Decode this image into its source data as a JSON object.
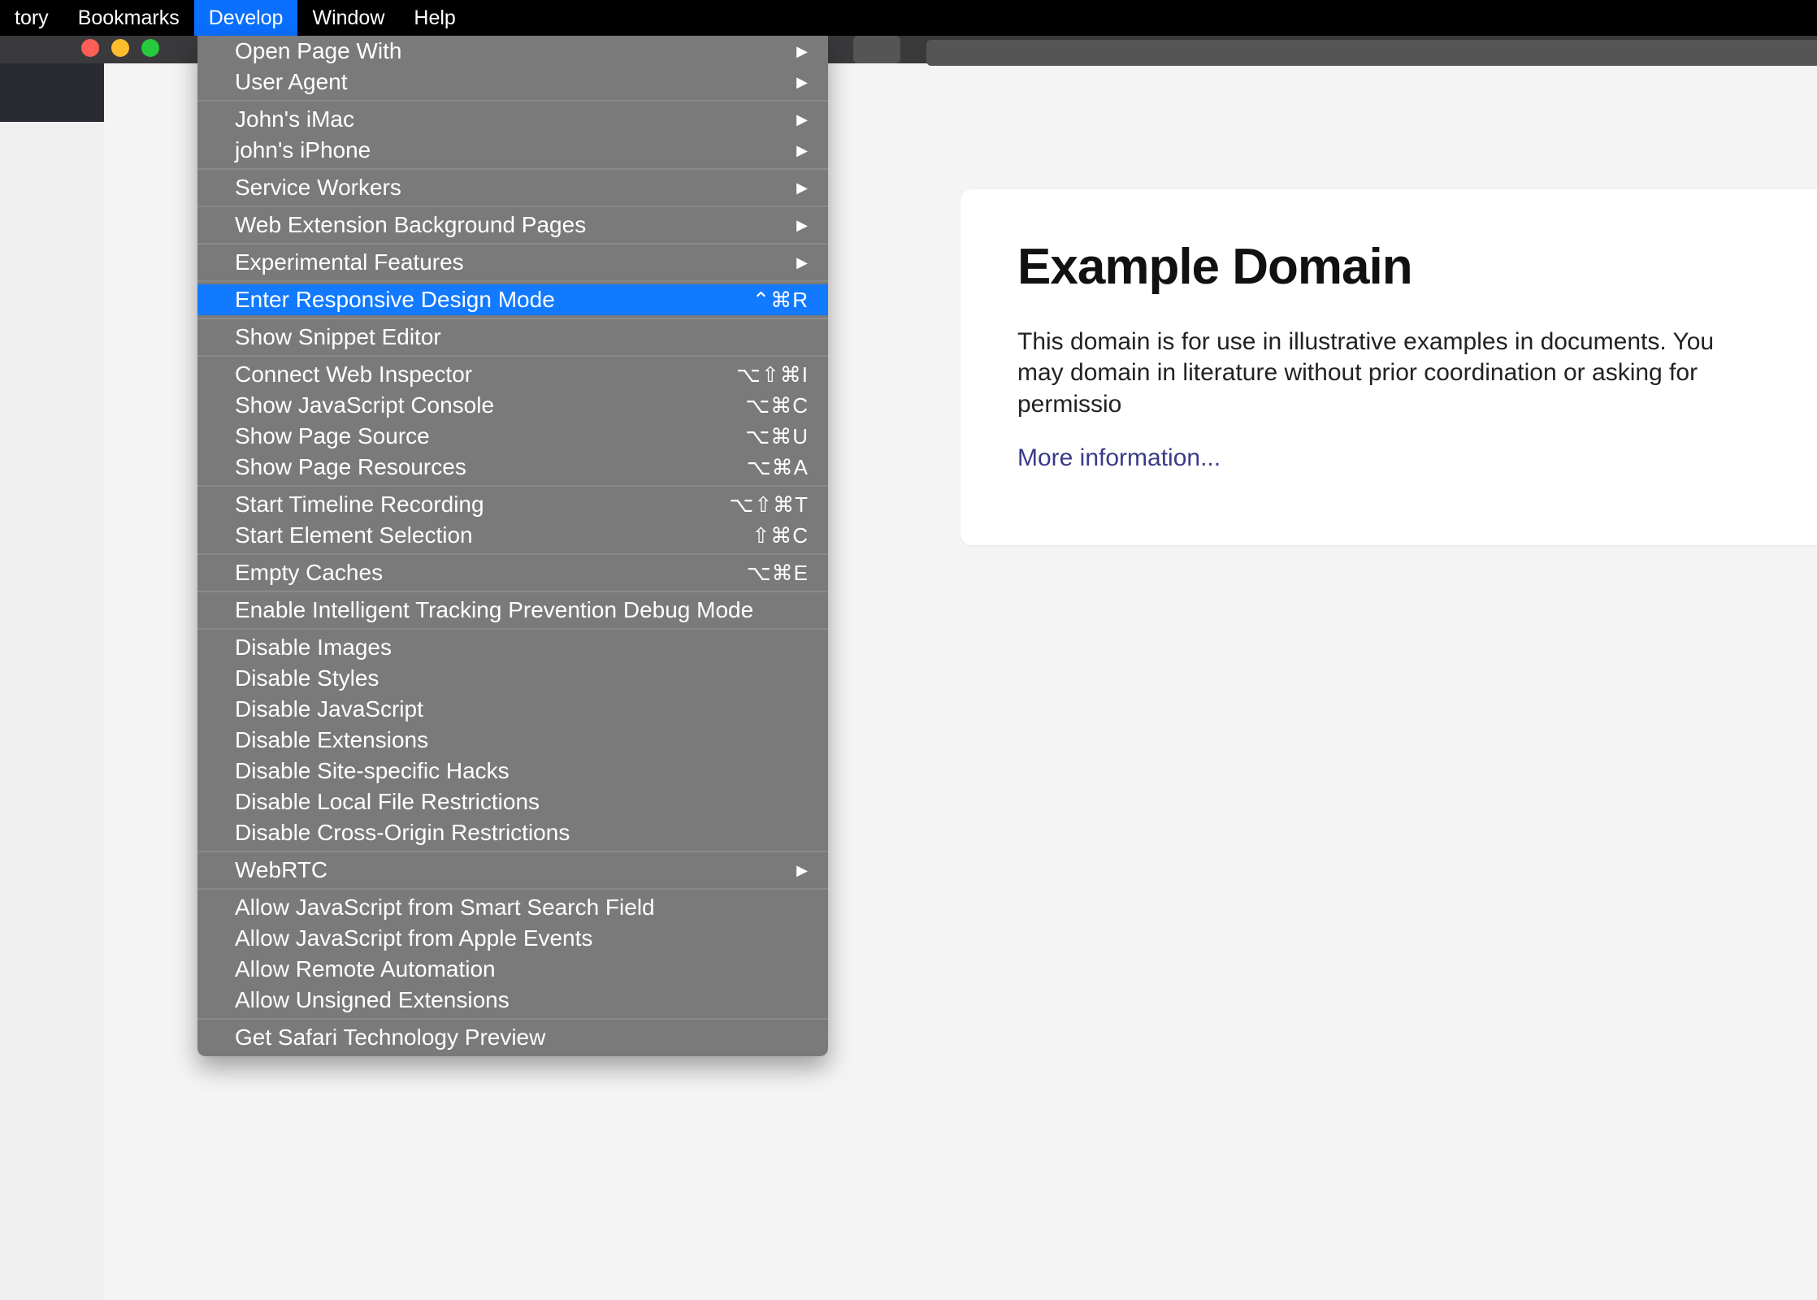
{
  "menubar": {
    "items": [
      {
        "label": "tory"
      },
      {
        "label": "Bookmarks"
      },
      {
        "label": "Develop",
        "selected": true
      },
      {
        "label": "Window"
      },
      {
        "label": "Help"
      }
    ]
  },
  "dropdown": {
    "groups": [
      [
        {
          "label": "Open Page With",
          "submenu": true
        },
        {
          "label": "User Agent",
          "submenu": true
        }
      ],
      [
        {
          "label": "John's iMac",
          "submenu": true
        },
        {
          "label": "john's iPhone",
          "submenu": true
        }
      ],
      [
        {
          "label": "Service Workers",
          "submenu": true
        }
      ],
      [
        {
          "label": "Web Extension Background Pages",
          "submenu": true
        }
      ],
      [
        {
          "label": "Experimental Features",
          "submenu": true
        }
      ],
      [
        {
          "label": "Enter Responsive Design Mode",
          "shortcut": "⌃⌘R",
          "highlighted": true
        }
      ],
      [
        {
          "label": "Show Snippet Editor"
        }
      ],
      [
        {
          "label": "Connect Web Inspector",
          "shortcut": "⌥⇧⌘I"
        },
        {
          "label": "Show JavaScript Console",
          "shortcut": "⌥⌘C"
        },
        {
          "label": "Show Page Source",
          "shortcut": "⌥⌘U"
        },
        {
          "label": "Show Page Resources",
          "shortcut": "⌥⌘A"
        }
      ],
      [
        {
          "label": "Start Timeline Recording",
          "shortcut": "⌥⇧⌘T"
        },
        {
          "label": "Start Element Selection",
          "shortcut": "⇧⌘C"
        }
      ],
      [
        {
          "label": "Empty Caches",
          "shortcut": "⌥⌘E"
        }
      ],
      [
        {
          "label": "Enable Intelligent Tracking Prevention Debug Mode"
        }
      ],
      [
        {
          "label": "Disable Images"
        },
        {
          "label": "Disable Styles"
        },
        {
          "label": "Disable JavaScript"
        },
        {
          "label": "Disable Extensions"
        },
        {
          "label": "Disable Site-specific Hacks"
        },
        {
          "label": "Disable Local File Restrictions"
        },
        {
          "label": "Disable Cross-Origin Restrictions"
        }
      ],
      [
        {
          "label": "WebRTC",
          "submenu": true
        }
      ],
      [
        {
          "label": "Allow JavaScript from Smart Search Field"
        },
        {
          "label": "Allow JavaScript from Apple Events"
        },
        {
          "label": "Allow Remote Automation"
        },
        {
          "label": "Allow Unsigned Extensions"
        }
      ],
      [
        {
          "label": "Get Safari Technology Preview"
        }
      ]
    ]
  },
  "page": {
    "title": "Example Domain",
    "paragraph": "This domain is for use in illustrative examples in documents. You may domain in literature without prior coordination or asking for permissio",
    "link": "More information..."
  }
}
